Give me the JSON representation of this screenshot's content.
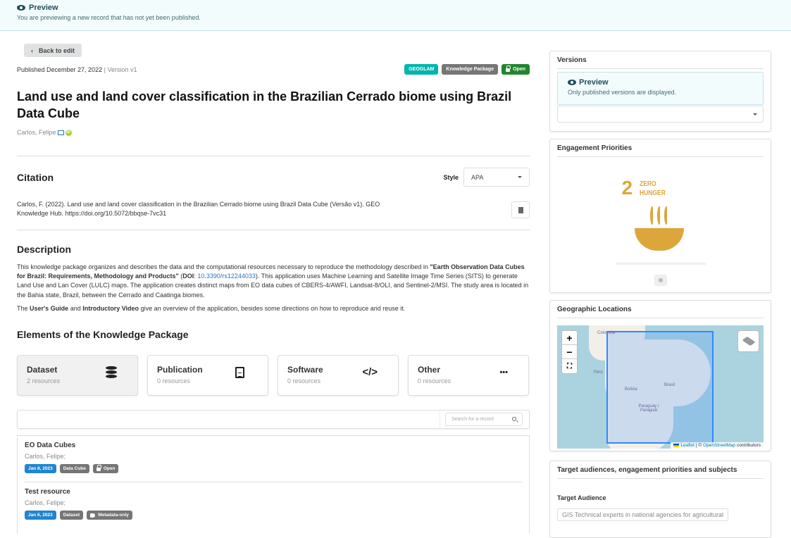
{
  "banner": {
    "title": "Preview",
    "message": "You are previewing a new record that has not yet been published."
  },
  "back_button": "Back to edit",
  "published": {
    "text": "Published December 27, 2022",
    "separator": "|",
    "version": "Version v1"
  },
  "labels": [
    {
      "text": "GEOGLAM",
      "color": "#00b5ad"
    },
    {
      "text": "Knowledge Package",
      "color": "#767676"
    },
    {
      "text": "Open",
      "color": "#21862d",
      "icon": "lock-open-icon"
    }
  ],
  "title": "Land use and land cover classification in the Brazilian Cerrado biome using Brazil Data Cube",
  "author": {
    "name": "Carlos, Felipe",
    "orcid_glyph": "iD"
  },
  "citation": {
    "heading": "Citation",
    "style_label": "Style",
    "style_value": "APA",
    "text": "Carlos, F. (2022). Land use and land cover classification in the Brazilian Cerrado biome using Brazil Data Cube (Versão v1). GEO Knowledge Hub. https://doi.org/10.5072/bbqse-7vc31"
  },
  "description": {
    "heading": "Description",
    "p1_a": "This knowledge package organizes and describes the data and the computational resources necessary to reproduce the methodology described in ",
    "p1_bold": "\"Earth Observation Data Cubes for Brazil: Requirements, Methodology and Products\"",
    "p1_b": " (",
    "p1_doi_label": "DOI",
    "p1_c": ": ",
    "p1_doi": "10.3390/rs12244033",
    "p1_d": "). This application uses Machine Learning and Satellite Image Time Series (SITS) to generate Land Use and Lan Cover (LULC) maps. The application creates distinct maps from EO data cubes of CBERS-4/AWFI, Landsat-8/OLI, and Sentinel-2/MSI. The study area is located in the Bahia state, Brazil, between the Cerrado and Caatinga biomes.",
    "p2_a": "The ",
    "p2_b1": "User's Guide",
    "p2_and": " and ",
    "p2_b2": "Introductory Video",
    "p2_c": " give an overview of the application, besides some directions on how to reproduce and reuse it."
  },
  "elements": {
    "heading": "Elements of the Knowledge Package",
    "cards": [
      {
        "name": "Dataset",
        "count": "2 resources",
        "icon": "database-icon"
      },
      {
        "name": "Publication",
        "count": "0 resources",
        "icon": "document-icon"
      },
      {
        "name": "Software",
        "count": "0 resources",
        "icon": "code-icon",
        "glyph": "</>"
      },
      {
        "name": "Other",
        "count": "0 resources",
        "icon": "ellipsis-icon",
        "glyph": "•••"
      }
    ]
  },
  "search": {
    "placeholder": "Search for a record"
  },
  "results": [
    {
      "title": "EO Data Cubes",
      "authors": "Carlos, Felipe;",
      "date": "Jan 8, 2023",
      "type": "Data Cube",
      "access": "Open"
    },
    {
      "title": "Test resource",
      "authors": "Carlos, Felipe;",
      "date": "Jan 6, 2023",
      "type": "Dataset",
      "access": "Metadata-only"
    }
  ],
  "sidebar": {
    "versions": {
      "heading": "Versions",
      "preview_title": "Preview",
      "preview_msg": "Only published versions are displayed."
    },
    "engagement": {
      "heading": "Engagement Priorities",
      "sdg_number": "2",
      "sdg_line1": "ZERO",
      "sdg_line2": "HUNGER",
      "sdg_color": "#dda63a"
    },
    "geo": {
      "heading": "Geographic Locations",
      "zoom_in": "+",
      "zoom_out": "−",
      "fullscreen": "⛶",
      "places": [
        "Colombia",
        "Perú",
        "Bolivia",
        "Brasil",
        "Paraguay / Paraguái"
      ],
      "attribution_leaflet": "Leaflet",
      "attribution_sep": "| ©",
      "attribution_osm": "OpenStreetMap",
      "attribution_tail": "contributors"
    },
    "targets": {
      "heading": "Target audiences, engagement priorities and subjects",
      "label": "Target Audience",
      "chip": "GIS Technical experts in national agencies for agricultural"
    }
  }
}
